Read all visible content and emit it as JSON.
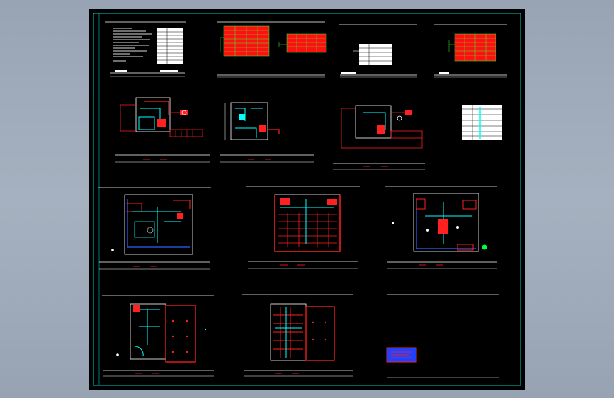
{
  "drawing": {
    "background": "#000000",
    "frame_color": "#00c8c8",
    "line_color": "#ffffff",
    "accent_colors": {
      "wall": "#ff2020",
      "pipe": "#00ffff",
      "fixture": "#3060ff",
      "table": "#ff1010",
      "grid": "#30ff30",
      "stamp": "#2040ff",
      "marker": "#00ff40"
    }
  },
  "sheets": [
    {
      "kind": "notes"
    },
    {
      "kind": "schedule-pair"
    },
    {
      "kind": "legend-table"
    },
    {
      "kind": "schedule-single"
    },
    {
      "kind": "riser-plan"
    },
    {
      "kind": "riser-plan"
    },
    {
      "kind": "riser-plan"
    },
    {
      "kind": "symbol-table"
    },
    {
      "kind": "floor-plan"
    },
    {
      "kind": "floor-plan"
    },
    {
      "kind": "floor-plan"
    },
    {
      "kind": "floor-plan"
    },
    {
      "kind": "floor-plan"
    },
    {
      "kind": "title-stamp"
    }
  ]
}
